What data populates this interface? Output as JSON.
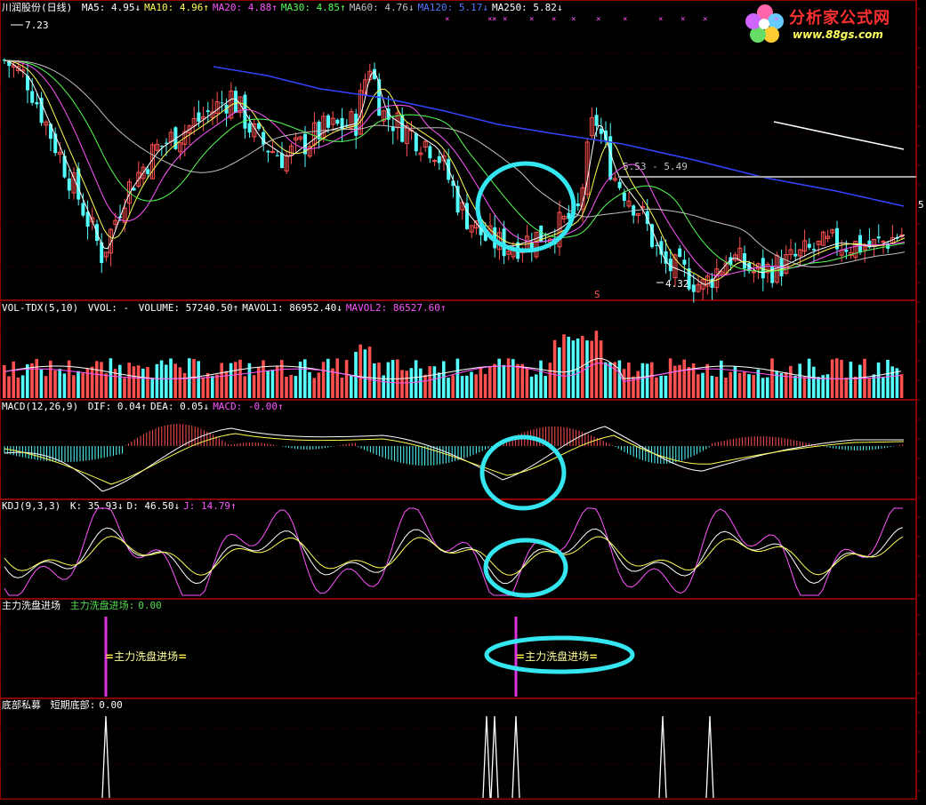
{
  "main": {
    "stock": "川润股份",
    "period": "(日线)",
    "ma": [
      {
        "label": "MA5:",
        "value": "4.95",
        "arrow": "↓",
        "color": "#ffffff"
      },
      {
        "label": "MA10:",
        "value": "4.96",
        "arrow": "↑",
        "color": "#ffff55"
      },
      {
        "label": "MA20:",
        "value": "4.88",
        "arrow": "↑",
        "color": "#ff55ff"
      },
      {
        "label": "MA30:",
        "value": "4.85",
        "arrow": "↑",
        "color": "#55ff55"
      },
      {
        "label": "MA60:",
        "value": "4.76",
        "arrow": "↓",
        "color": "#c0c0c0"
      },
      {
        "label": "MA120:",
        "value": "5.17",
        "arrow": "↓",
        "color": "#5577ff"
      },
      {
        "label": "MA250:",
        "value": "5.82",
        "arrow": "↓",
        "color": "#ffffff"
      }
    ],
    "high_label": "7.23",
    "low_label": "4.32",
    "range_label": "5.53 - 5.49",
    "s_marker": "S",
    "right_tick": "5"
  },
  "vol": {
    "name": "VOL-TDX(5,10)",
    "vvol": "VVOL: -",
    "items": [
      {
        "label": "VOLUME:",
        "value": "57240.50",
        "arrow": "↑",
        "color": "#ffffff"
      },
      {
        "label": "MAVOL1:",
        "value": "86952.40",
        "arrow": "↓",
        "color": "#ffffff"
      },
      {
        "label": "MAVOL2:",
        "value": "86527.60",
        "arrow": "↑",
        "color": "#ff55ff"
      }
    ]
  },
  "macd": {
    "name": "MACD(12,26,9)",
    "items": [
      {
        "label": "DIF:",
        "value": "0.04",
        "arrow": "↑",
        "color": "#ffffff"
      },
      {
        "label": "DEA:",
        "value": "0.05",
        "arrow": "↓",
        "color": "#ffffff"
      },
      {
        "label": "MACD:",
        "value": "-0.00",
        "arrow": "↑",
        "color": "#ff55ff"
      }
    ]
  },
  "kdj": {
    "name": "KDJ(9,3,3)",
    "items": [
      {
        "label": "K:",
        "value": "35.93",
        "arrow": "↓",
        "color": "#ffffff"
      },
      {
        "label": "D:",
        "value": "46.50",
        "arrow": "↓",
        "color": "#ffffff"
      },
      {
        "label": "J:",
        "value": "14.79",
        "arrow": "↑",
        "color": "#ff55ff"
      }
    ]
  },
  "wash": {
    "name": "主力洗盘进场",
    "item_label": "主力洗盘进场:",
    "item_value": "0.00",
    "signal_text": "主力洗盘进场"
  },
  "bottom": {
    "name": "底部私募",
    "item_label": "短期底部:",
    "item_value": "0.00"
  },
  "logo": {
    "title": "分析家公式网",
    "url": "www.88gs.com"
  },
  "colors": {
    "up": "#ff5050",
    "down": "#54ffff",
    "grid": "#8a0000",
    "highlight": "#33e6f0"
  },
  "chart_data": {
    "type": "line",
    "note_values": "approximate read of price trend from start to end",
    "series": [
      {
        "name": "MA5",
        "values": [
          6.9,
          6.5,
          5.7,
          5.8,
          6.2,
          6.4,
          6.1,
          6.2,
          5.9,
          5.4,
          5.0,
          5.0,
          5.9,
          5.6,
          5.2,
          4.7,
          4.6,
          4.7,
          5.0,
          4.95
        ]
      },
      {
        "name": "MA120",
        "values": [
          6.3,
          6.2,
          6.15,
          6.1,
          6.0,
          5.9,
          5.8,
          5.7,
          5.55,
          5.4,
          5.3,
          5.2,
          5.17
        ]
      }
    ]
  }
}
